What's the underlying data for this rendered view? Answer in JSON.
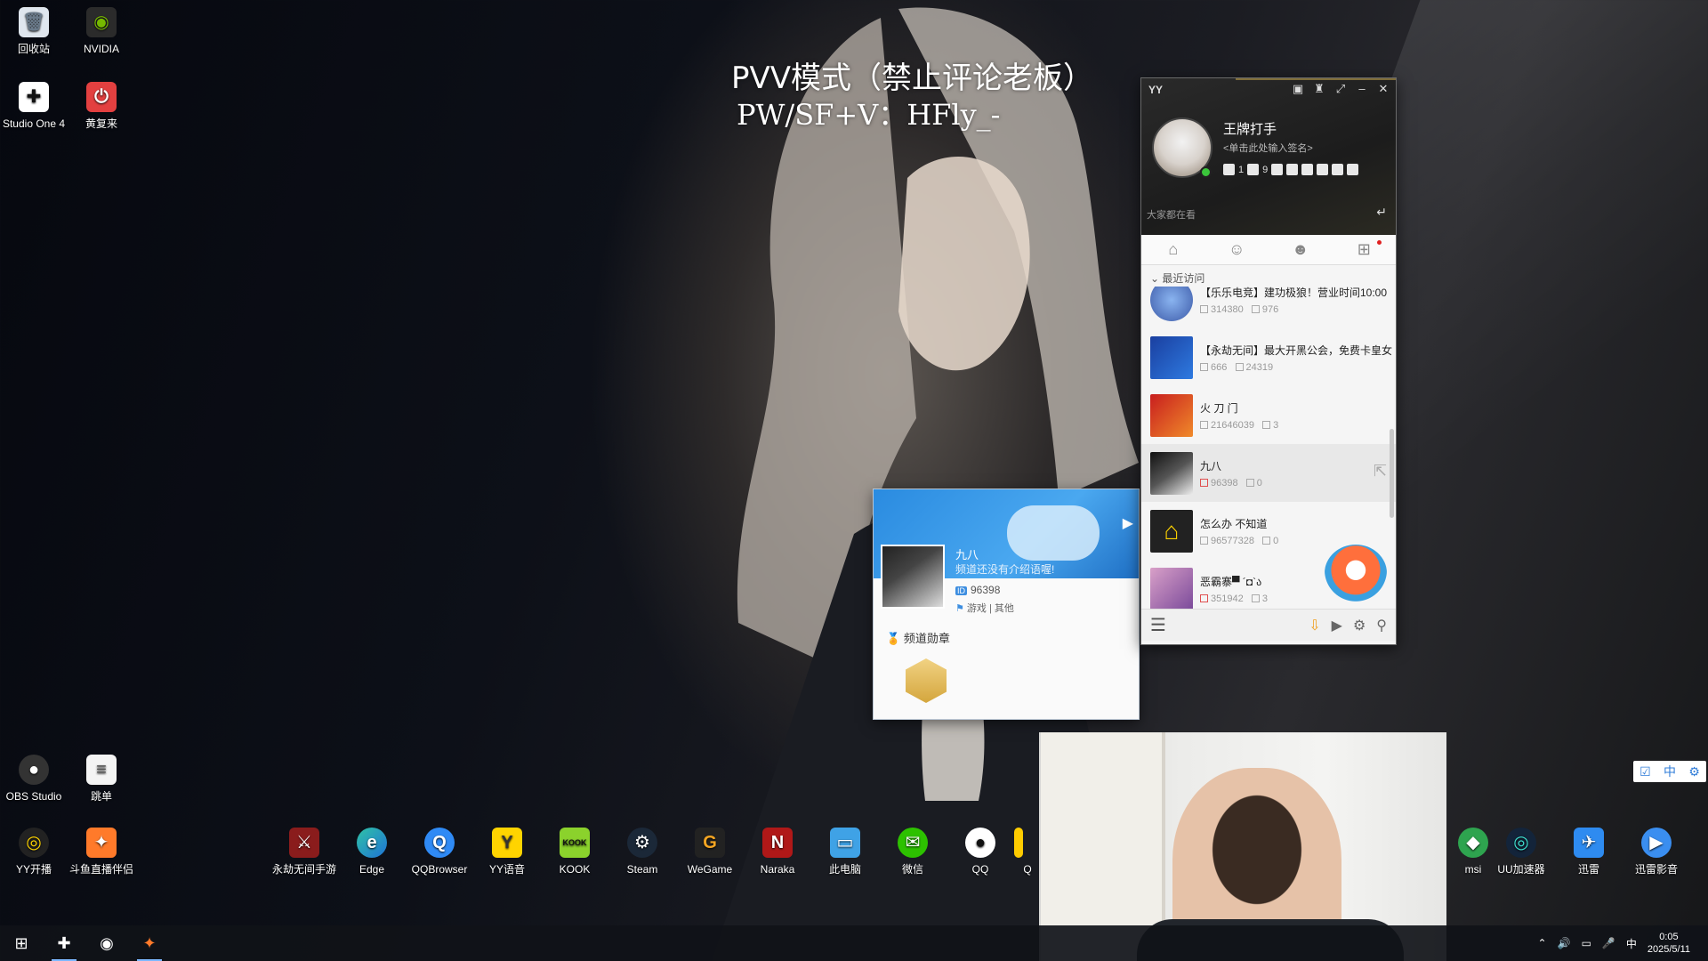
{
  "overlay": {
    "line1": "PVV模式（禁止评论老板）",
    "line2": "PW/SF+V：HFly_-"
  },
  "desktop_icons": {
    "recycle": "回收站",
    "nvidia": "NVIDIA",
    "studio_one": "Studio One 4",
    "restore": "黄复来",
    "obs": "OBS Studio",
    "playlist": "跳单",
    "yy_kaibo": "YY开播",
    "douyu": "斗鱼直播伴侣",
    "yongjie_mobile": "永劫无间手游",
    "edge": "Edge",
    "qqbrowser": "QQBrowser",
    "yyvoice": "YY语音",
    "kook": "KOOK",
    "steam": "Steam",
    "wegame": "WeGame",
    "naraka": "Naraka",
    "thispc": "此电脑",
    "wechat": "微信",
    "qq": "QQ",
    "q_partial": "Q",
    "msi": "msi",
    "uu": "UU加速器",
    "xunlei": "迅雷",
    "xunlei_player": "迅雷影音"
  },
  "yy": {
    "window_title": "YY",
    "username": "王牌打手",
    "signature": "<单击此处输入签名>",
    "badge_counts": [
      "1",
      "9"
    ],
    "watching_label": "大家都在看",
    "section_label": "最近访问",
    "channels": [
      {
        "name": "【乐乐电竞】建功极狼！营业时间10:00",
        "id": "314380",
        "count": "976"
      },
      {
        "name": "【永劫无间】最大开黑公会，免费卡皇女",
        "id": "666",
        "count": "24319"
      },
      {
        "name": "火 刀 门",
        "id": "21646039",
        "count": "3"
      },
      {
        "name": "九八",
        "id": "96398",
        "count": "0"
      },
      {
        "name": "怎么办 不知道",
        "id": "96577328",
        "count": "0"
      },
      {
        "name": "恶霸寨▀ ´◘`ა",
        "id": "351942",
        "count": "3"
      }
    ]
  },
  "card": {
    "name": "九八",
    "description": "频道还没有介绍语喔!",
    "id_badge": "ID",
    "id": "96398",
    "category": "游戏 | 其他",
    "medal_title": "频道勋章"
  },
  "ime": {
    "lang": "中"
  },
  "tray": {
    "ime": "中",
    "time": "0:05",
    "date": "2025/5/11"
  },
  "colors": {
    "accent_blue": "#2a8be0",
    "online_green": "#3bc63b",
    "gold": "#c9a84a"
  }
}
